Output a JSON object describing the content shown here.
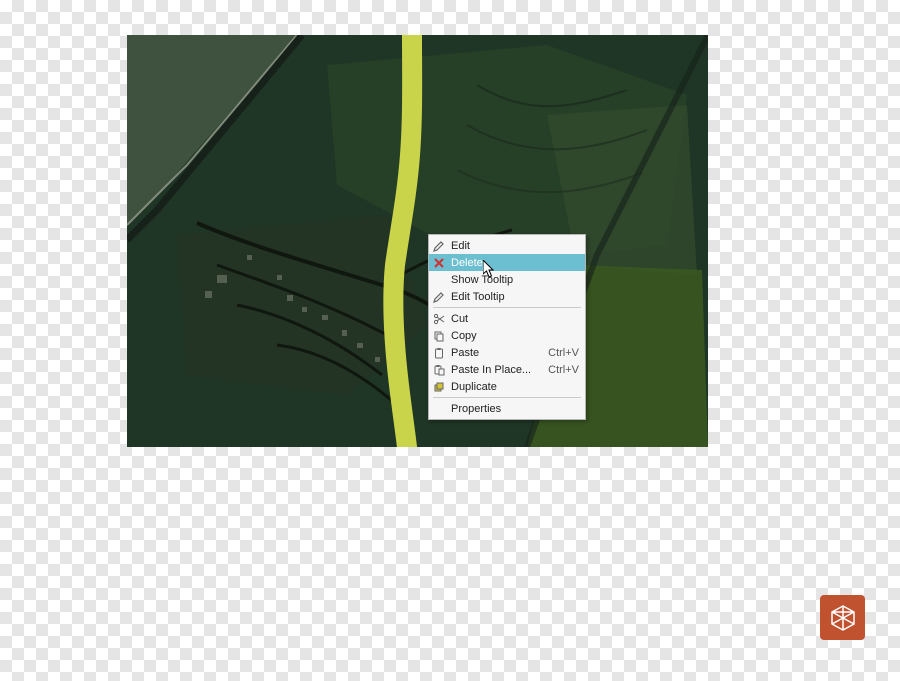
{
  "context_menu": {
    "items": [
      {
        "label": "Edit",
        "icon": "pencil-icon",
        "shortcut": ""
      },
      {
        "label": "Delete",
        "icon": "delete-icon",
        "shortcut": "",
        "hover": true
      },
      {
        "label": "Show Tooltip",
        "icon": "",
        "shortcut": ""
      },
      {
        "label": "Edit Tooltip",
        "icon": "pencil-icon",
        "shortcut": ""
      },
      {
        "sep": true
      },
      {
        "label": "Cut",
        "icon": "scissors-icon",
        "shortcut": ""
      },
      {
        "label": "Copy",
        "icon": "copy-icon",
        "shortcut": ""
      },
      {
        "label": "Paste",
        "icon": "paste-icon",
        "shortcut": "Ctrl+V"
      },
      {
        "label": "Paste In Place...",
        "icon": "paste-in-place-icon",
        "shortcut": "Ctrl+V"
      },
      {
        "label": "Duplicate",
        "icon": "duplicate-icon",
        "shortcut": ""
      },
      {
        "sep": true
      },
      {
        "label": "Properties",
        "icon": "",
        "shortcut": ""
      }
    ]
  },
  "logo": {
    "name": "cube-logo"
  },
  "scene": {
    "selected_feature": "road-highlight",
    "selected_color": "#c9d44a"
  }
}
